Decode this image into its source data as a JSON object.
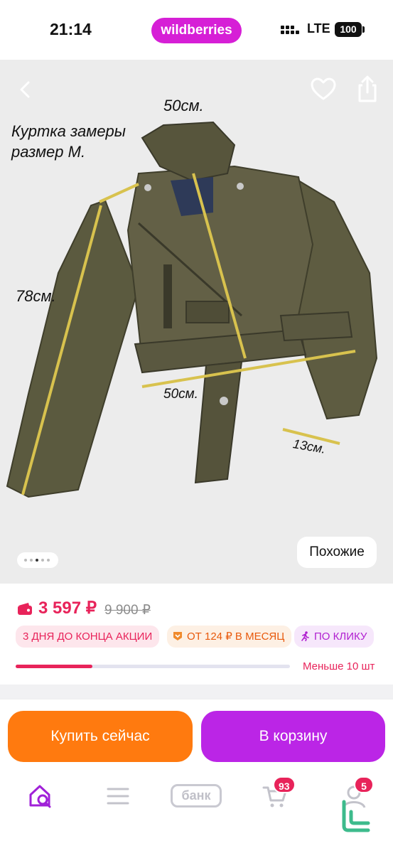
{
  "status_bar": {
    "time": "21:14",
    "brand": "wildberries",
    "network": "LTE",
    "battery": "100"
  },
  "gallery": {
    "caption_line1": "Куртка замеры",
    "caption_line2": "размер М.",
    "measure_shoulders": "50см.",
    "measure_sleeve": "78см.",
    "measure_waist": "50см.",
    "measure_cuff": "13см.",
    "similar_label": "Похожие",
    "slides_count": 5,
    "active_slide": 3
  },
  "price": {
    "current": "3 597 ₽",
    "old": "9 900 ₽",
    "color": "#e8235a"
  },
  "badges": [
    {
      "label": "3 ДНЯ ДО КОНЦА АКЦИИ"
    },
    {
      "label": "ОТ 124 ₽ В МЕСЯЦ",
      "icon": "installment-icon"
    },
    {
      "label": "ПО КЛИКУ",
      "icon": "runner-icon"
    }
  ],
  "stock": {
    "label": "Меньше 10 шт",
    "level_percent": 28
  },
  "actions": {
    "buy_now": "Купить сейчас",
    "add_to_cart": "В корзину"
  },
  "tab_bar": {
    "bank_label": "банк",
    "cart_count": "93",
    "profile_count": "5"
  },
  "colors": {
    "accent_pink": "#e8235a",
    "buy_orange": "#ff7a0f",
    "cart_purple": "#bb25e6",
    "brand_magenta": "#d61fd6"
  }
}
